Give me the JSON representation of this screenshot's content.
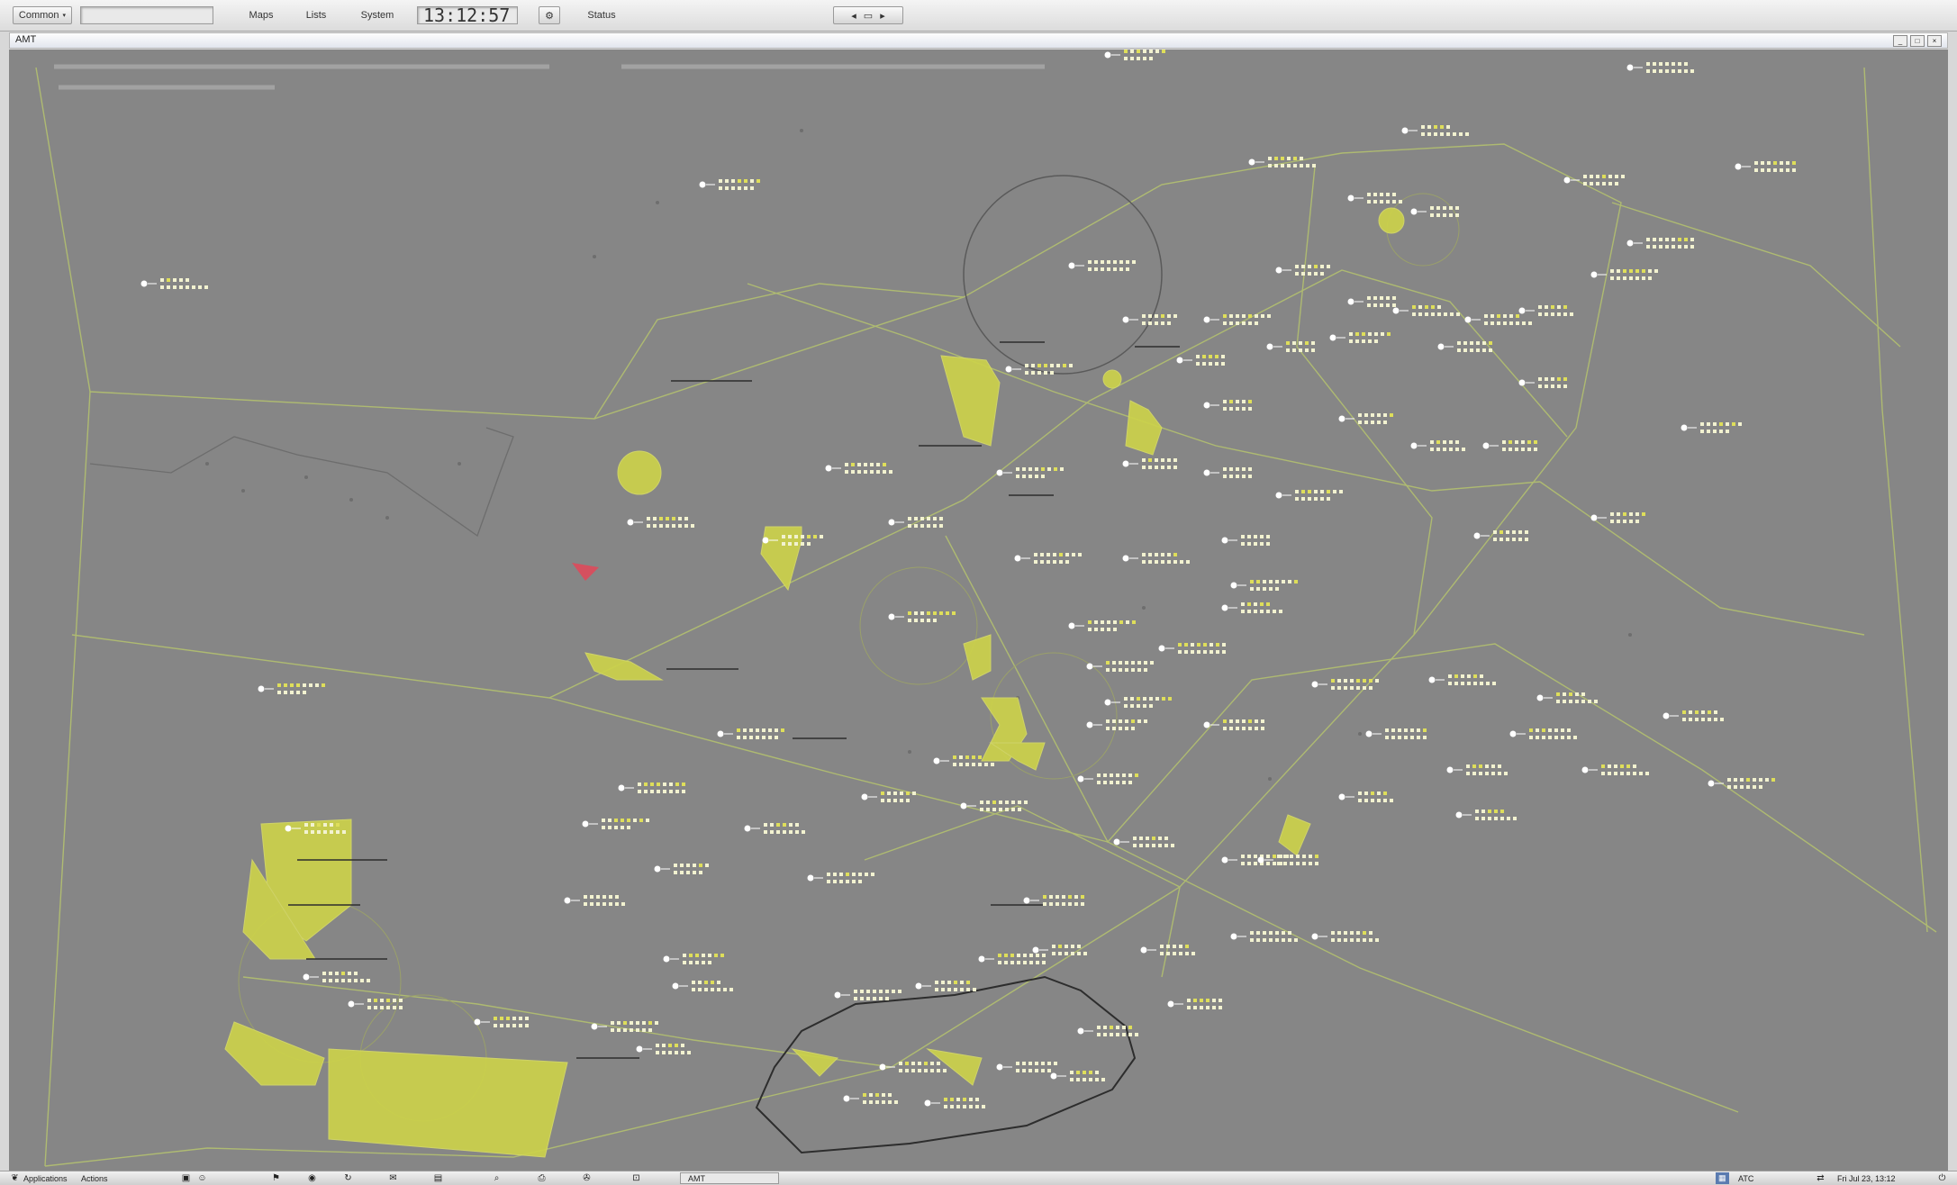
{
  "toolbar": {
    "dropdown_label": "Common",
    "menu_items": [
      "Maps",
      "Lists",
      "System"
    ],
    "clock": "13:12:57",
    "status_label": "Status"
  },
  "window": {
    "title": "AMT"
  },
  "taskbar": {
    "menu": [
      "Applications",
      "Actions"
    ],
    "task_label": "AMT",
    "tray_label": "ATC",
    "datetime": "Fri Jul 23, 13:12"
  },
  "colors": {
    "background": "#868686",
    "sector_lines": "#b6c46e",
    "restricted_areas": "#cdd34a",
    "tracks": "#ffffff",
    "labels": "#f2f2d0"
  }
}
